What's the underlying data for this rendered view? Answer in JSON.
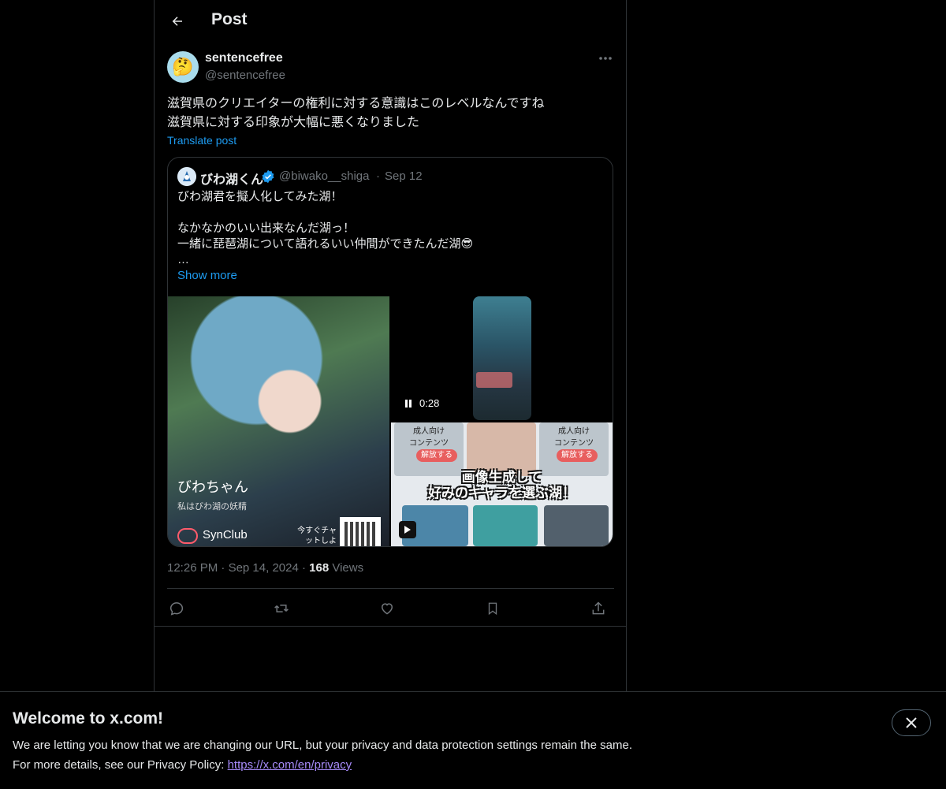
{
  "header": {
    "title": "Post"
  },
  "post": {
    "display_name": "sentencefree",
    "handle": "@sentencefree",
    "avatar_emoji": "🤔",
    "text_lines": [
      "滋賀県のクリエイターの権利に対する意識はこのレベルなんですね",
      "滋賀県に対する印象が大幅に悪くなりました"
    ],
    "translate_label": "Translate post",
    "time": "12:26 PM",
    "date": "Sep 14, 2024",
    "views_count": "168",
    "views_label": "Views"
  },
  "quote": {
    "display_name": "びわ湖くん",
    "handle": "@biwako__shiga",
    "separator": "·",
    "date": "Sep 12",
    "text_lines": [
      "びわ湖君を擬人化してみた湖！",
      "",
      "なかなかのいい出来なんだ湖っ！",
      "一緒に琵琶湖について語れるいい仲間ができたんだ湖😎",
      "…"
    ],
    "show_more_label": "Show more",
    "media": {
      "left_image": {
        "title": "びわちゃん",
        "subtitle": "私はびわ湖の妖精",
        "brand": "SynClub",
        "cta": "今すぐチャットしよう！"
      },
      "video": {
        "time": "0:28"
      },
      "right_image": {
        "tile_label": "成人向け\nコンテンツ",
        "unlock_label": "解放する",
        "banner_line1": "画像生成して",
        "banner_line2": "好みのキャラを選ぶ湖！"
      }
    }
  },
  "meta_separator": "·",
  "banner": {
    "title": "Welcome to x.com!",
    "line1": "We are letting you know that we are changing our URL, but your privacy and data protection settings remain the same.",
    "line2_prefix": "For more details, see our Privacy Policy: ",
    "link": "https://x.com/en/privacy"
  },
  "colors": {
    "background": "#000000",
    "text": "#e7e9ea",
    "muted": "#71767b",
    "accent": "#1d9bf0",
    "border": "#2f3336"
  },
  "icons": {
    "back": "arrow-left-icon",
    "more": "more-horizontal-icon",
    "verified": "verified-badge-icon",
    "reply": "reply-icon",
    "repost": "repost-icon",
    "like": "heart-icon",
    "bookmark": "bookmark-icon",
    "share": "share-icon",
    "close": "close-icon",
    "pause": "pause-icon"
  }
}
